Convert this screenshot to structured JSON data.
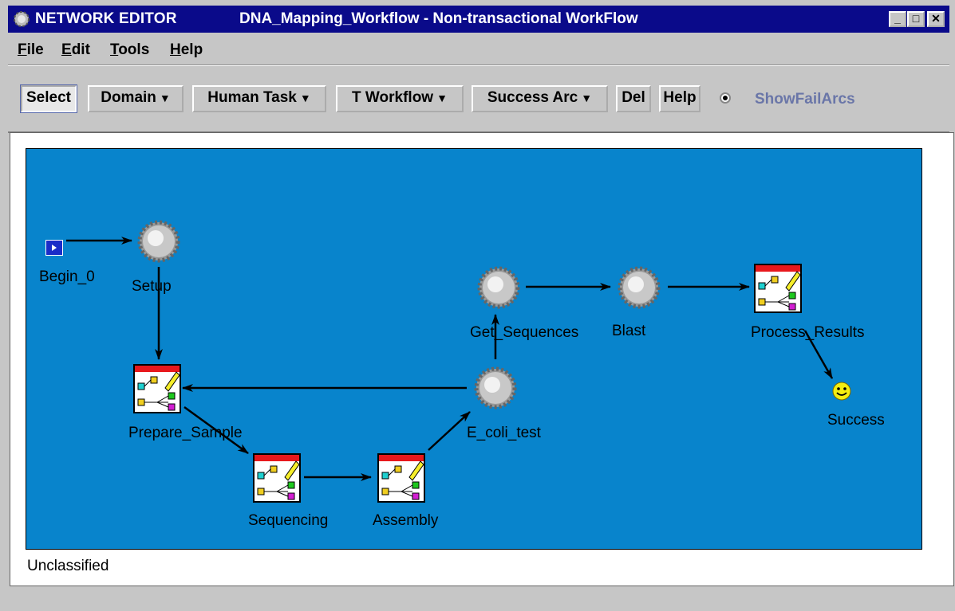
{
  "window": {
    "app_title": "NETWORK EDITOR",
    "document_title": "DNA_Mapping_Workflow - Non-transactional WorkFlow",
    "minimize_label": "_",
    "maximize_label": "□",
    "close_label": "✕"
  },
  "menu": {
    "file": "File",
    "edit": "Edit",
    "tools": "Tools",
    "help": "Help"
  },
  "toolbar": {
    "select": "Select",
    "domain": "Domain",
    "human_task": "Human Task",
    "t_workflow": "T Workflow",
    "success_arc": "Success Arc",
    "del": "Del",
    "help": "Help",
    "show_fail_arcs": "ShowFailArcs",
    "caret": "▼"
  },
  "canvas": {
    "background_color": "#0884cc",
    "nodes": {
      "begin": "Begin_0",
      "setup": "Setup",
      "prepare_sample": "Prepare_Sample",
      "sequencing": "Sequencing",
      "assembly": "Assembly",
      "e_coli_test": "E_coli_test",
      "get_sequences": "Get_Sequences",
      "blast": "Blast",
      "process_results": "Process_Results",
      "success": "Success"
    }
  },
  "classification": "Unclassified"
}
